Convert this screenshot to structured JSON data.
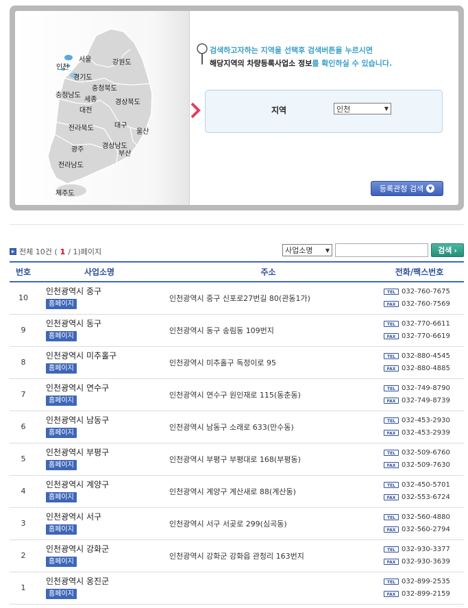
{
  "map": {
    "regions": [
      {
        "name": "서울"
      },
      {
        "name": "인천"
      },
      {
        "name": "강원도"
      },
      {
        "name": "경기도"
      },
      {
        "name": "충청남도"
      },
      {
        "name": "충청북도"
      },
      {
        "name": "세종"
      },
      {
        "name": "대전"
      },
      {
        "name": "경상북도"
      },
      {
        "name": "전라북도"
      },
      {
        "name": "대구"
      },
      {
        "name": "울산"
      },
      {
        "name": "광주"
      },
      {
        "name": "경상남도"
      },
      {
        "name": "부산"
      },
      {
        "name": "전라남도"
      },
      {
        "name": "제주도"
      }
    ]
  },
  "guide": {
    "line1": "검색하고자하는 지역을 선택후 검색버튼을 누르시면",
    "line2_pre": "해당지역의 차량등록사업소 정보",
    "line2_hl": "를 확인하실 수 있습니다."
  },
  "region_filter": {
    "label": "지역",
    "selected": "인천"
  },
  "office_search_button": "등록관청 검색",
  "list": {
    "summary_prefix": "전체 10건 (",
    "current_page": "1",
    "summary_suffix": " / 1)페이지",
    "search_type": "사업소명",
    "search_input_value": "",
    "search_button": "검색"
  },
  "table": {
    "headers": [
      "번호",
      "사업소명",
      "주소",
      "전화/팩스번호"
    ],
    "homepage_label": "홈페이지",
    "tel_tag": "TEL",
    "fax_tag": "FAX",
    "rows": [
      {
        "no": "10",
        "name": "인천광역시 중구",
        "address": "인천광역시 중구 신포로27번길 80(관동1가)",
        "tel": "032-760-7675",
        "fax": "032-760-7569"
      },
      {
        "no": "9",
        "name": "인천광역시 동구",
        "address": "인천광역시 동구 송림동 109번지",
        "tel": "032-770-6611",
        "fax": "032-770-6619"
      },
      {
        "no": "8",
        "name": "인천광역시 미추홀구",
        "address": "인천광역시 미추홀구 독정이로 95",
        "tel": "032-880-4545",
        "fax": "032-880-4885"
      },
      {
        "no": "7",
        "name": "인천광역시 연수구",
        "address": "인천광역시 연수구 원인재로 115(동춘동)",
        "tel": "032-749-8790",
        "fax": "032-749-8739"
      },
      {
        "no": "6",
        "name": "인천광역시 남동구",
        "address": "인천광역시 남동구 소래로 633(만수동)",
        "tel": "032-453-2930",
        "fax": "032-453-2939"
      },
      {
        "no": "5",
        "name": "인천광역시 부평구",
        "address": "인천광역시 부평구 부평대로 168(부평동)",
        "tel": "032-509-6760",
        "fax": "032-509-7630"
      },
      {
        "no": "4",
        "name": "인천광역시 계양구",
        "address": "인천광역시 계양구 계산새로 88(계산동)",
        "tel": "032-450-5701",
        "fax": "032-553-6724"
      },
      {
        "no": "3",
        "name": "인천광역시 서구",
        "address": "인천광역시 서구 서곶로 299(심곡동)",
        "tel": "032-560-4880",
        "fax": "032-560-2794"
      },
      {
        "no": "2",
        "name": "인천광역시 강화군",
        "address": "인천광역시 강화군 강화읍 관청리 163번지",
        "tel": "032-930-3377",
        "fax": "032-930-3639"
      },
      {
        "no": "1",
        "name": "인천광역시 옹진군",
        "address": "",
        "tel": "032-899-2535",
        "fax": "032-899-2159"
      }
    ]
  }
}
